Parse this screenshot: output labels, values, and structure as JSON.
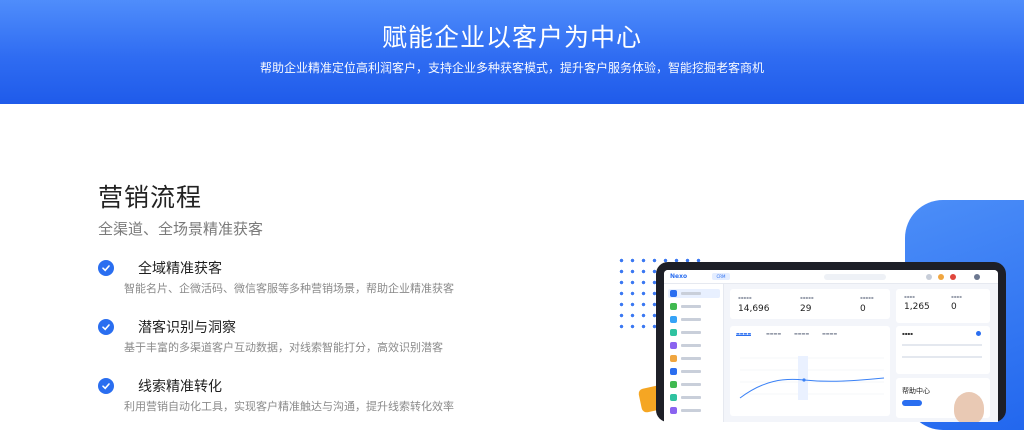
{
  "banner": {
    "title": "赋能企业以客户为中心",
    "subtitle": "帮助企业精准定位高利润客户，支持企业多种获客模式，提升客户服务体验，智能挖掘老客商机"
  },
  "section": {
    "title": "营销流程",
    "subtitle": "全渠道、全场景精准获客"
  },
  "features": [
    {
      "title": "全域精准获客",
      "desc": "智能名片、企微活码、微信客服等多种营销场景，帮助企业精准获客"
    },
    {
      "title": "潜客识别与洞察",
      "desc": "基于丰富的多渠道客户互动数据，对线索智能打分，高效识别潜客"
    },
    {
      "title": "线索精准转化",
      "desc": "利用营销自动化工具，实现客户精准触达与沟通，提升线索转化效率"
    }
  ],
  "dashboard": {
    "stats": [
      "14,696",
      "29",
      "0"
    ],
    "side_stats": [
      "1,265",
      "0"
    ],
    "help_title": "帮助中心"
  },
  "colors": {
    "accent": "#2a6ef0",
    "banner_top": "#4f8dfb",
    "banner_bottom": "#1f5bea"
  }
}
